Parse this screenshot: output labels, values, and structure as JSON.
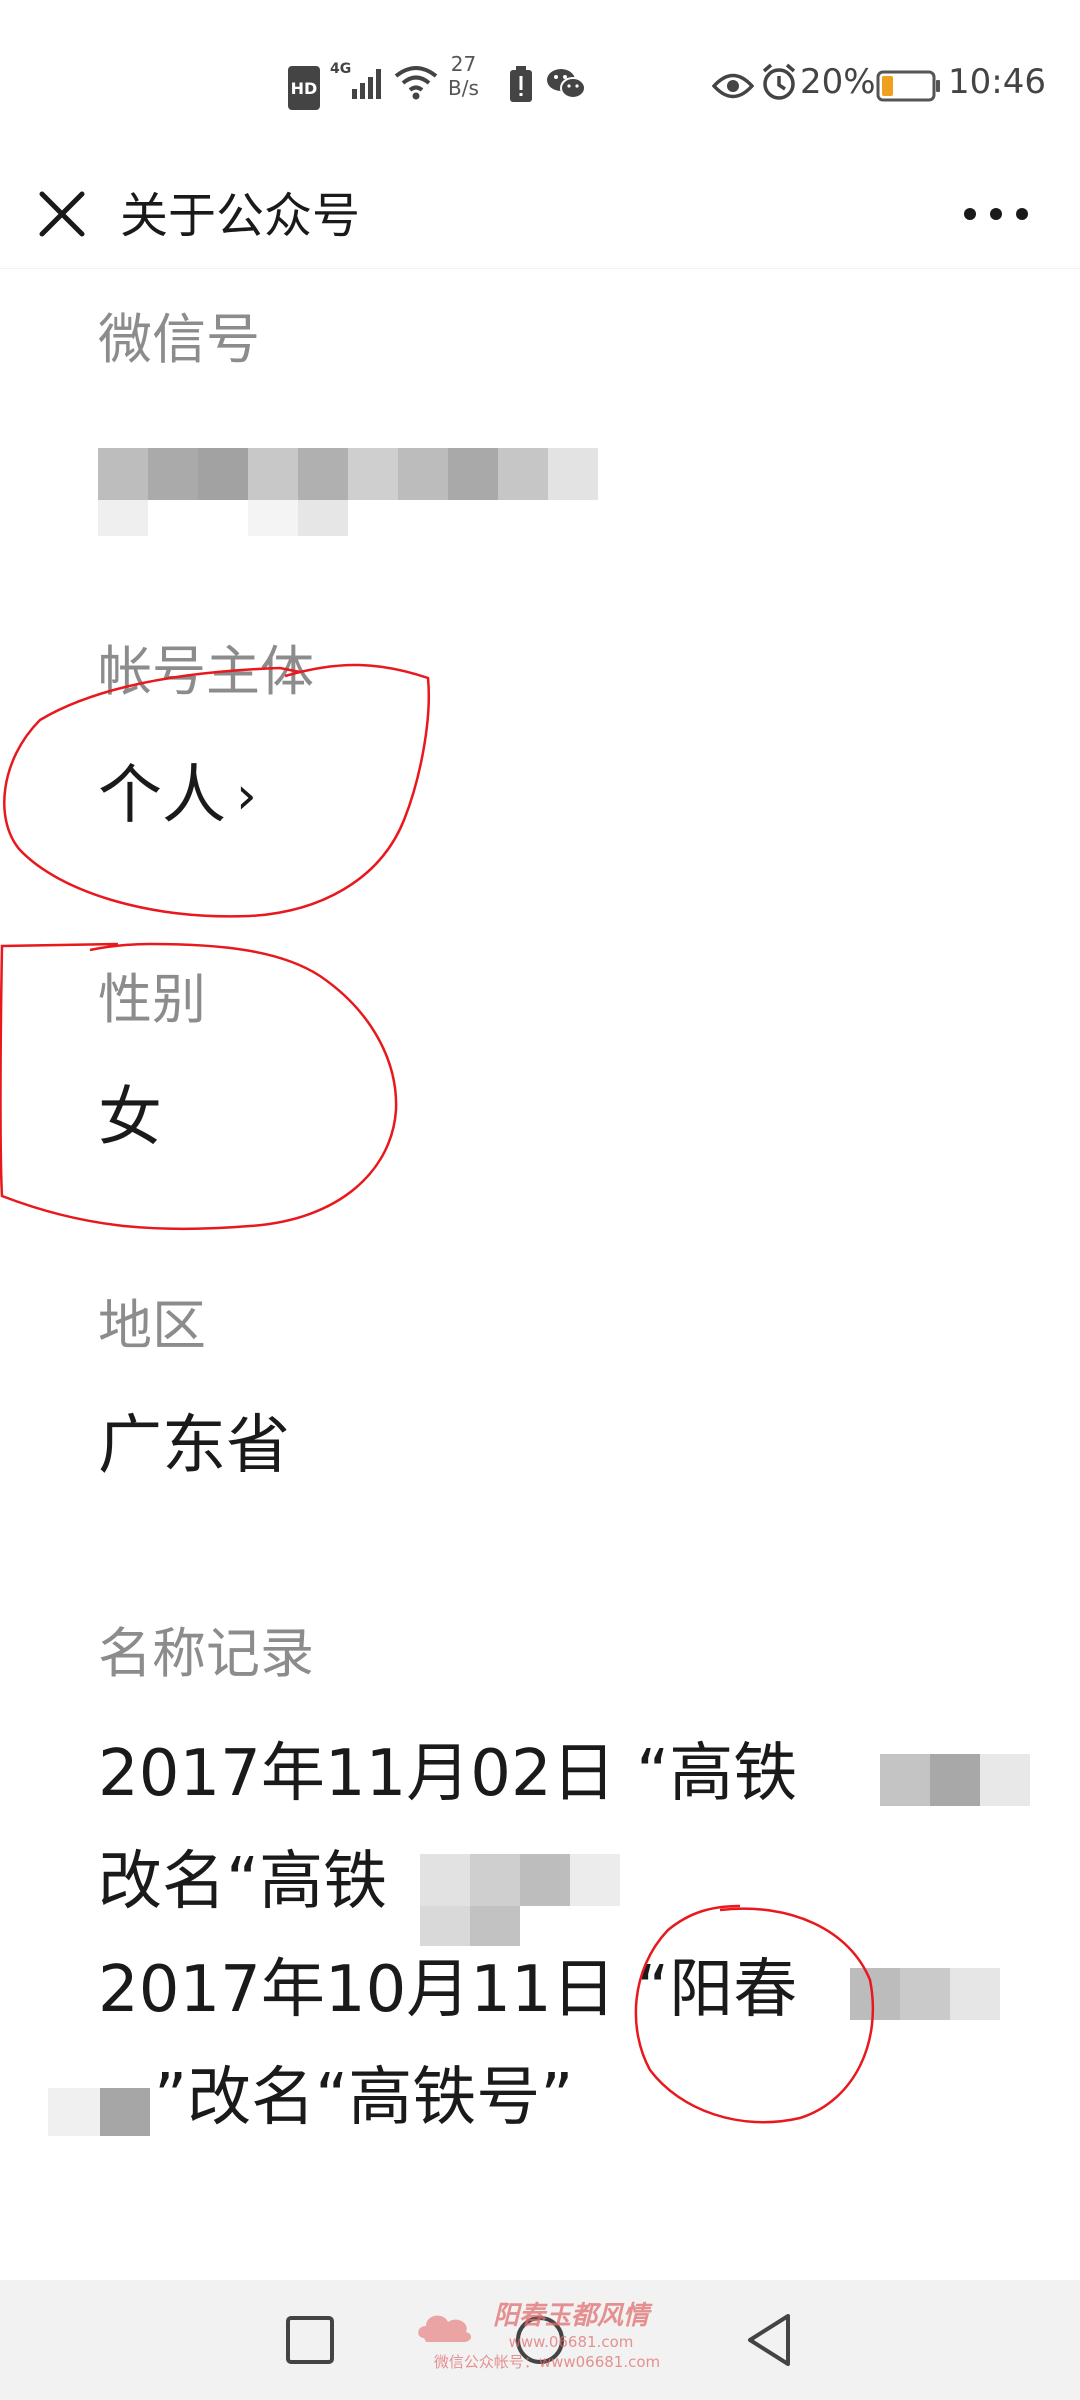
{
  "status_bar": {
    "hd_badge": "HD",
    "network_type": "4G",
    "net_speed_value": "27",
    "net_speed_unit": "B/s",
    "battery_percent": "20%",
    "time": "10:46",
    "icons": [
      "hd-icon",
      "signal-icon",
      "wifi-icon",
      "battery-alert-icon",
      "wechat-icon",
      "eye-icon",
      "alarm-icon",
      "battery-icon"
    ]
  },
  "header": {
    "title": "关于公众号",
    "close_icon": "close-icon",
    "more_icon": "more-icon"
  },
  "fields": {
    "wechat_id": {
      "label": "微信号"
    },
    "account_subject": {
      "label": "帐号主体",
      "value": "个人",
      "chevron": "›"
    },
    "gender": {
      "label": "性别",
      "value": "女"
    },
    "region": {
      "label": "地区",
      "value": "广东省"
    },
    "name_history": {
      "label": "名称记录",
      "lines": [
        "2017年11月02日 “高铁",
        "改名“高铁",
        "2017年10月11日 “阳春",
        "”改名“高铁号”"
      ]
    }
  },
  "nav_bar": {
    "icons": [
      "recents-square-icon",
      "home-circle-icon",
      "back-triangle-icon"
    ]
  },
  "watermark": {
    "main_text": "阳春玉都风情",
    "url_text": "www.06681.com",
    "sub_text": "微信公众帐号：www06681.com"
  },
  "colors": {
    "annotation_red": "#e8181c",
    "label_gray": "#8c8c8c",
    "nav_bar_bg": "#f2f2f2"
  }
}
